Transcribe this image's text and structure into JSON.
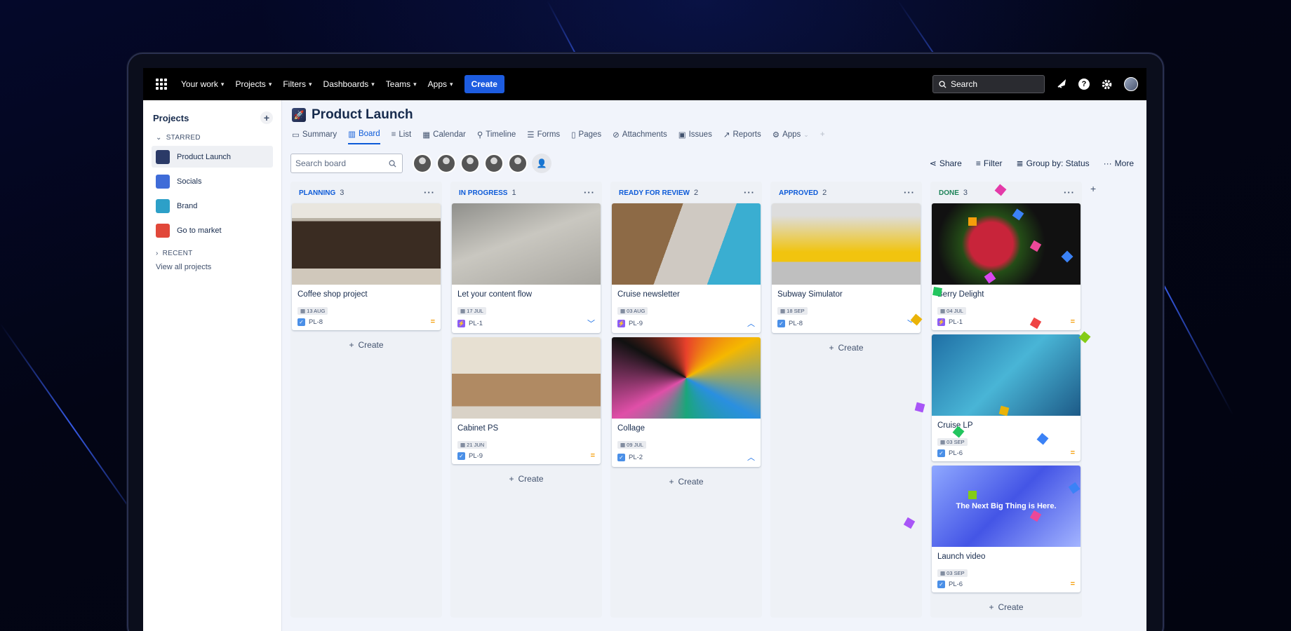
{
  "topnav": {
    "items": [
      {
        "label": "Your work"
      },
      {
        "label": "Projects"
      },
      {
        "label": "Filters"
      },
      {
        "label": "Dashboards"
      },
      {
        "label": "Teams"
      },
      {
        "label": "Apps"
      }
    ],
    "create_label": "Create",
    "search_placeholder": "Search"
  },
  "sidebar": {
    "title": "Projects",
    "starred_label": "STARRED",
    "items": [
      {
        "label": "Product Launch",
        "color": "#2b3a67"
      },
      {
        "label": "Socials",
        "color": "#3f6cd8"
      },
      {
        "label": "Brand",
        "color": "#2da0c8"
      },
      {
        "label": "Go to market",
        "color": "#e1483a"
      }
    ],
    "recent_label": "RECENT",
    "view_all": "View all projects"
  },
  "project": {
    "title": "Product Launch"
  },
  "tabs": [
    {
      "label": "Summary",
      "icon": "summary-icon"
    },
    {
      "label": "Board",
      "icon": "board-icon"
    },
    {
      "label": "List",
      "icon": "list-icon"
    },
    {
      "label": "Calendar",
      "icon": "calendar-icon"
    },
    {
      "label": "Timeline",
      "icon": "timeline-icon"
    },
    {
      "label": "Forms",
      "icon": "forms-icon"
    },
    {
      "label": "Pages",
      "icon": "pages-icon"
    },
    {
      "label": "Attachments",
      "icon": "attachments-icon"
    },
    {
      "label": "Issues",
      "icon": "issues-icon"
    },
    {
      "label": "Reports",
      "icon": "reports-icon"
    },
    {
      "label": "Apps",
      "icon": "apps-icon"
    }
  ],
  "toolbar": {
    "search_placeholder": "Search board",
    "share": "Share",
    "filter": "Filter",
    "group_by": "Group by: Status",
    "more": "More"
  },
  "board": {
    "create_label": "Create",
    "columns": [
      {
        "name": "PLANNING",
        "count": "3",
        "cards": [
          {
            "title": "Coffee shop project",
            "date": "13 AUG",
            "key": "PL-8",
            "type": "task",
            "priority": "medium"
          }
        ]
      },
      {
        "name": "IN PROGRESS",
        "count": "1",
        "cards": [
          {
            "title": "Let your content flow",
            "date": "17 JUL",
            "key": "PL-1",
            "type": "bolt",
            "priority": "low"
          },
          {
            "title": "Cabinet PS",
            "date": "21 JUN",
            "key": "PL-9",
            "type": "task",
            "priority": "medium"
          }
        ]
      },
      {
        "name": "READY FOR REVIEW",
        "count": "2",
        "cards": [
          {
            "title": "Cruise newsletter",
            "date": "03 AUG",
            "key": "PL-9",
            "type": "bolt",
            "priority": "high"
          },
          {
            "title": "Collage",
            "date": "09 JUL",
            "key": "PL-2",
            "type": "task",
            "priority": "high"
          }
        ]
      },
      {
        "name": "APPROVED",
        "count": "2",
        "cards": [
          {
            "title": "Subway Simulator",
            "date": "18 SEP",
            "key": "PL-8",
            "type": "task",
            "priority": "low"
          }
        ]
      },
      {
        "name": "DONE",
        "count": "3",
        "cards": [
          {
            "title": "Berry Delight",
            "date": "04 JUL",
            "key": "PL-1",
            "type": "bolt",
            "priority": "medium"
          },
          {
            "title": "Cruise LP",
            "date": "03 SEP",
            "key": "PL-6",
            "type": "task",
            "priority": "medium"
          },
          {
            "title": "Launch video",
            "date": "03 SEP",
            "key": "PL-6",
            "type": "task",
            "priority": "medium",
            "image_text": "The Next Big Thing is Here."
          }
        ]
      }
    ]
  }
}
